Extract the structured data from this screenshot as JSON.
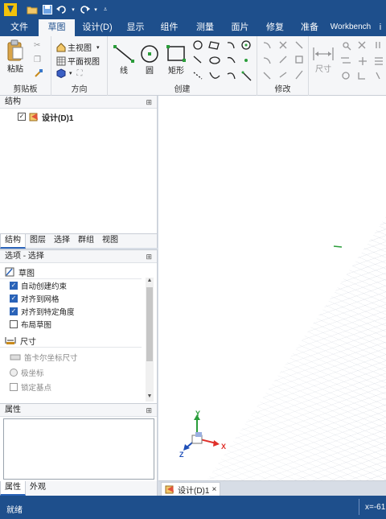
{
  "titlebar": {
    "icons": [
      "app-logo",
      "open-folder-icon",
      "save-icon",
      "undo-icon",
      "redo-icon",
      "customize-icon"
    ]
  },
  "tabs": [
    {
      "label": "文件",
      "active": false
    },
    {
      "label": "草图",
      "active": true
    },
    {
      "label": "设计(D)",
      "active": false
    },
    {
      "label": "显示",
      "active": false
    },
    {
      "label": "组件",
      "active": false
    },
    {
      "label": "测量",
      "active": false
    },
    {
      "label": "面片",
      "active": false
    },
    {
      "label": "修复",
      "active": false
    },
    {
      "label": "准备",
      "active": false
    },
    {
      "label": "Workbench",
      "active": false
    }
  ],
  "ribbon": {
    "clipboard": {
      "paste": "粘贴",
      "group": "剪贴板"
    },
    "orient": {
      "home_view": "主视图",
      "plan_view": "平面视图",
      "group": "方向"
    },
    "create": {
      "line": "线",
      "circle": "圆",
      "rectangle": "矩形",
      "group": "创建"
    },
    "modify": {
      "group": "修改"
    },
    "dimension": {
      "label": "尺寸"
    }
  },
  "structure": {
    "header": "结构",
    "pin": "ᵖ",
    "item": "设计(D)1"
  },
  "panel_tabs": [
    "结构",
    "图层",
    "选择",
    "群组",
    "视图"
  ],
  "options": {
    "header": "选项 - 选择",
    "sketch_section": "草图",
    "sketch_items": [
      {
        "label": "自动创建约束",
        "checked": true
      },
      {
        "label": "对齐到网格",
        "checked": true
      },
      {
        "label": "对齐到特定角度",
        "checked": true
      },
      {
        "label": "布局草图",
        "checked": false
      }
    ],
    "dimension_section": "尺寸",
    "dimension_items": [
      {
        "label": "笛卡尔坐标尺寸",
        "kind": "option"
      },
      {
        "label": "极坐标",
        "kind": "radio"
      },
      {
        "label": "锁定基点",
        "kind": "checkbox"
      }
    ]
  },
  "properties": {
    "header": "属性"
  },
  "props_tabs": [
    "属性",
    "外观"
  ],
  "doc_tab": {
    "label": "设计(D)1",
    "close": "×"
  },
  "axes": {
    "x": "X",
    "y": "Y",
    "z": "Z"
  },
  "status": {
    "left": "就绪",
    "right": "x=-61"
  },
  "colors": {
    "accent": "#1e4f8c",
    "grid": "#c8cdd8",
    "axis_x": "#e0302a",
    "axis_y": "#2a9d3a",
    "axis_z": "#1f4fb8"
  }
}
